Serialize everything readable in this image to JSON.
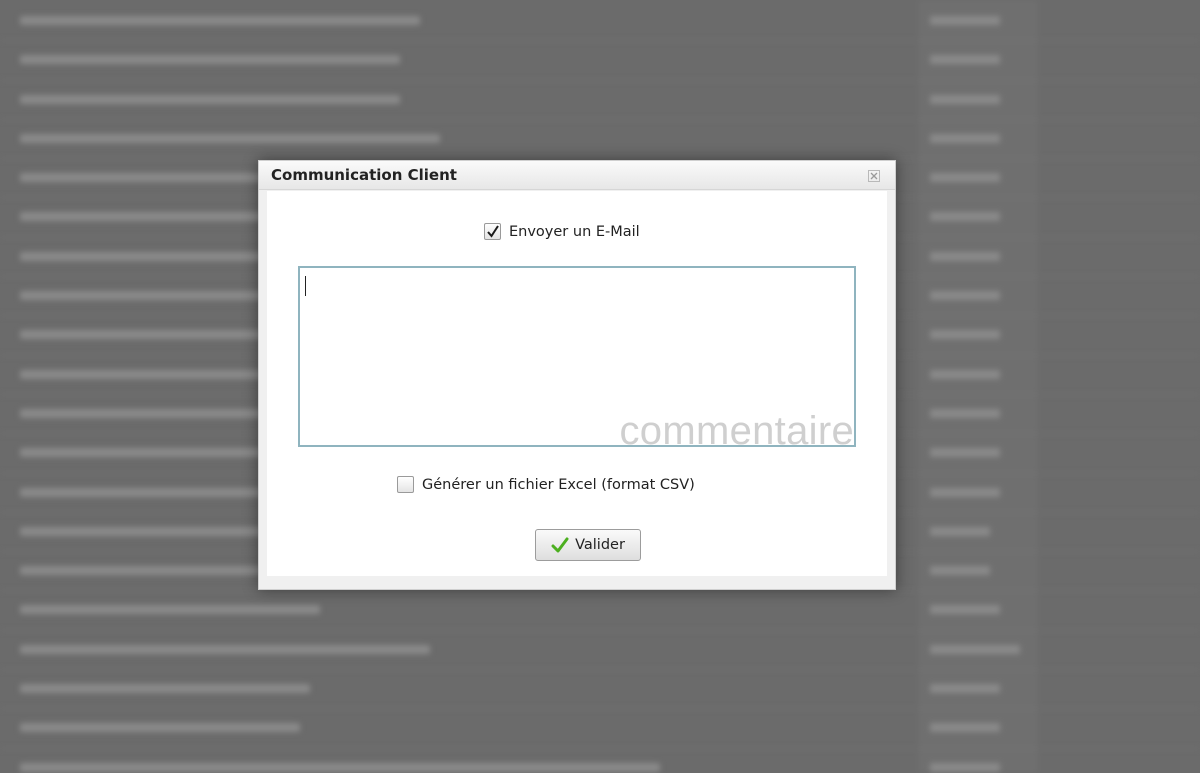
{
  "dialog": {
    "title": "Communication Client",
    "email_checkbox": {
      "label": "Envoyer un E-Mail",
      "checked": true
    },
    "comment": {
      "placeholder": "commentaire",
      "value": ""
    },
    "excel_checkbox": {
      "label": "Générer un fichier Excel (format CSV)",
      "checked": false
    },
    "submit_label": "Valider"
  },
  "icons": {
    "close": "close-icon",
    "check": "checkmark-icon",
    "submit": "green-checkmark-icon"
  },
  "colors": {
    "overlay": "#6b6b6b",
    "comment_border": "#8fb4bf",
    "placeholder": "#cfcfcf",
    "submit_check": "#4caf1f"
  }
}
